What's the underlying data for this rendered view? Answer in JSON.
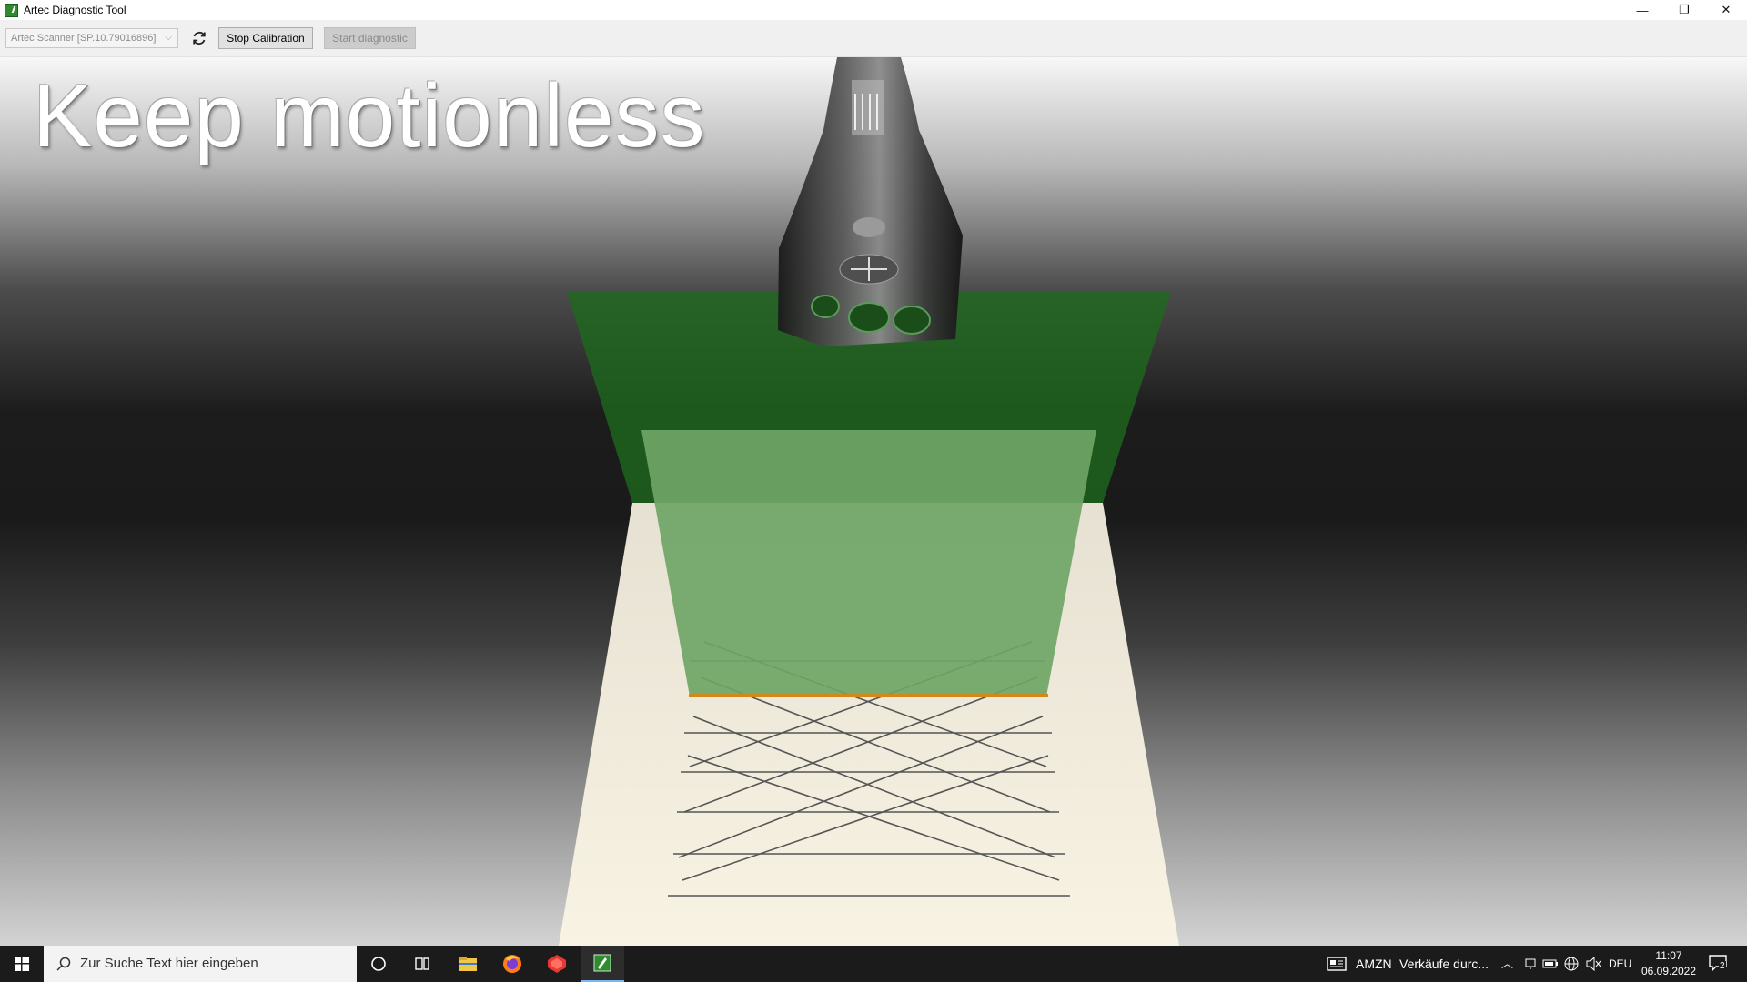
{
  "window": {
    "title": "Artec Diagnostic Tool",
    "minimize": "—",
    "restore": "❐",
    "close": "✕"
  },
  "toolbar": {
    "device_select_value": "Artec Scanner [SP.10.79016896]",
    "refresh_icon": "refresh-icon",
    "stop_calibration_label": "Stop Calibration",
    "start_diagnostic_label": "Start diagnostic"
  },
  "viewport": {
    "status_text": "Keep motionless",
    "colors": {
      "field_of_view_outer": "#1f6b1f",
      "field_of_view_inner": "#6fa566",
      "target_plate": "#f3ecdc",
      "highlight_line": "#d18a1a"
    }
  },
  "taskbar": {
    "search_placeholder": "Zur Suche Text hier eingeben",
    "news_ticker": "AMZN",
    "news_text": "Verkäufe durc...",
    "language": "DEU",
    "time": "11:07",
    "date": "06.09.2022",
    "notification_count": "2",
    "icons": [
      "windows-start-icon",
      "search-icon",
      "cortana-icon",
      "task-view-icon",
      "file-explorer-icon",
      "firefox-icon",
      "red-app-icon",
      "artec-app-icon",
      "news-icon",
      "chevron-up-icon",
      "device-icon",
      "battery-icon",
      "globe-icon",
      "speaker-muted-icon",
      "notification-icon"
    ]
  }
}
